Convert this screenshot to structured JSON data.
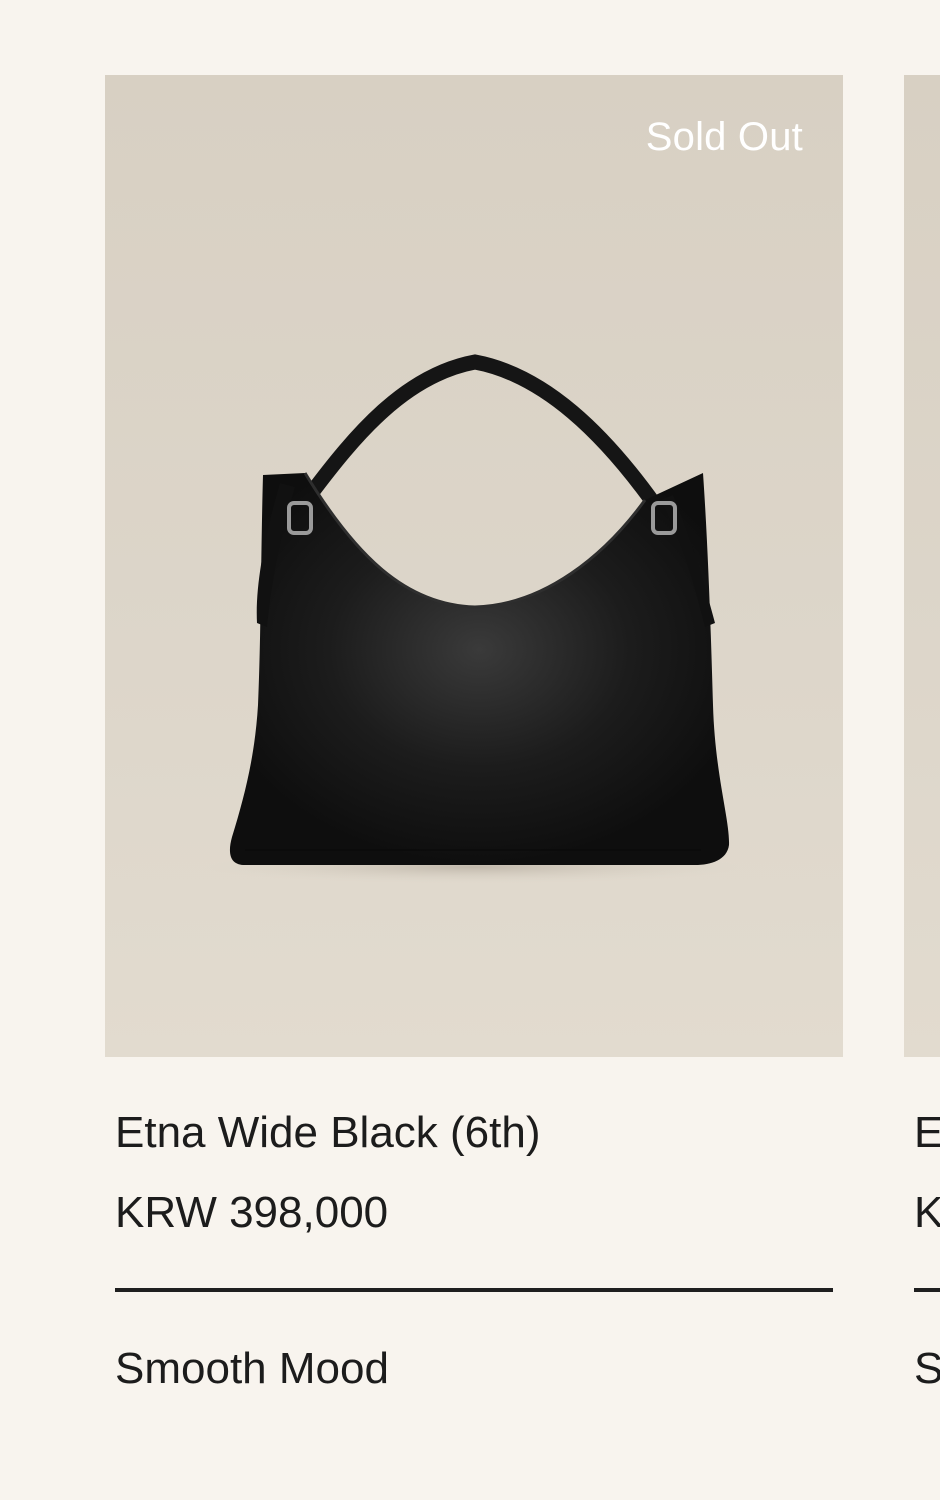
{
  "products": [
    {
      "name": "Etna Wide Black (6th)",
      "price": "KRW 398,000",
      "badge": "Sold Out",
      "tag": "Smooth Mood",
      "image_background": "#d8d0c3",
      "product_color": "#141414"
    },
    {
      "name": "E",
      "price": "K",
      "tag": "S"
    }
  ],
  "colors": {
    "page_background": "#f8f4ee",
    "text": "#1c1c1c",
    "badge_text": "#ffffff",
    "divider": "#1f1f1f"
  }
}
